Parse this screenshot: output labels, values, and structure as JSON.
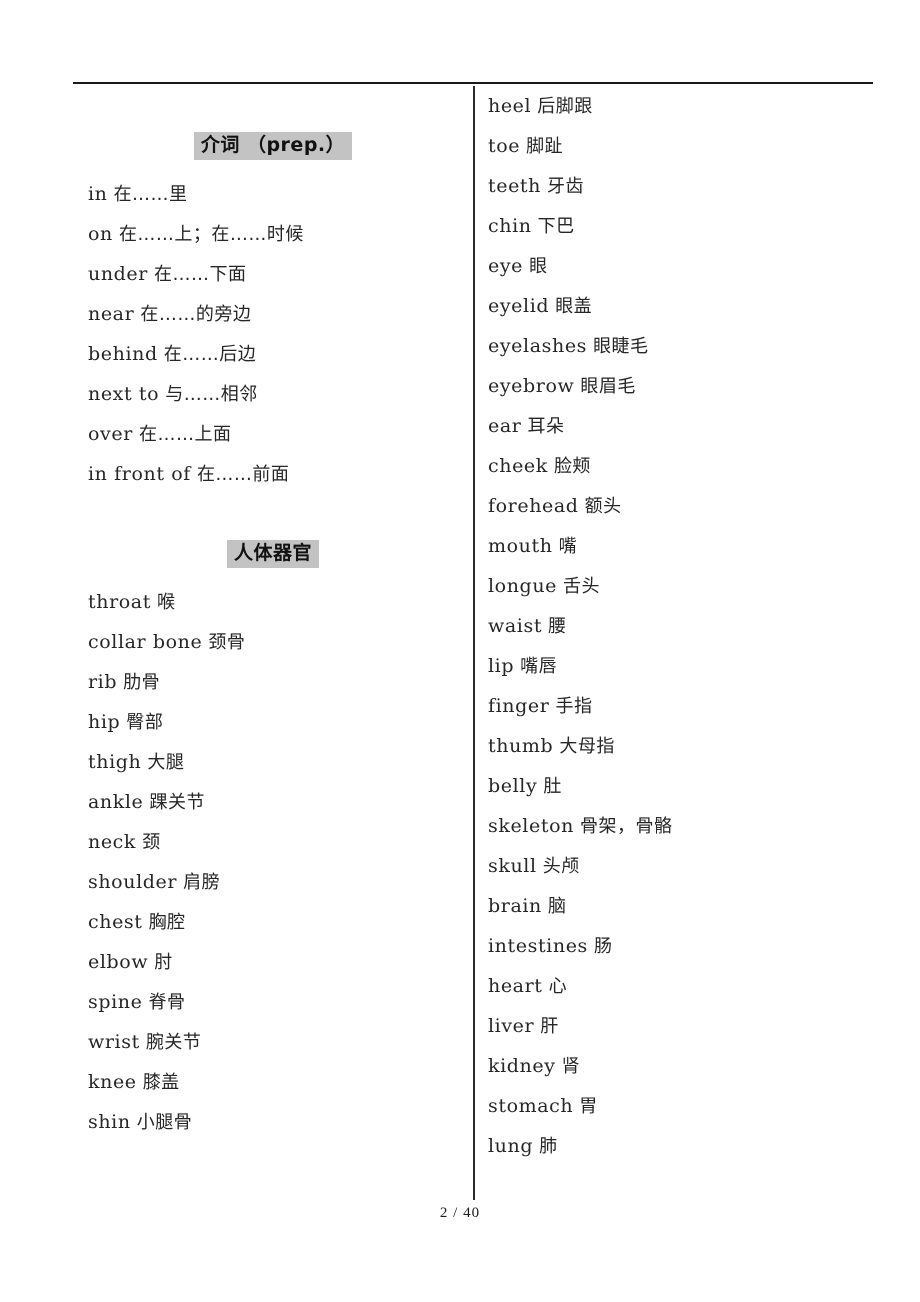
{
  "document": {
    "footer": "2 / 40"
  },
  "left_column": {
    "sections": [
      {
        "heading": "介词 （prep.）",
        "entries": [
          {
            "en": "in",
            "zh": "在……里"
          },
          {
            "en": "on",
            "zh": "在……上；在……时候"
          },
          {
            "en": "under",
            "zh": "在……下面"
          },
          {
            "en": "near",
            "zh": "在……的旁边"
          },
          {
            "en": "behind",
            "zh": "在……后边"
          },
          {
            "en": "next to",
            "zh": "与……相邻"
          },
          {
            "en": "over",
            "zh": "在……上面"
          },
          {
            "en": "in front of",
            "zh": "在……前面"
          }
        ]
      },
      {
        "heading": "人体器官",
        "entries": [
          {
            "en": "throat",
            "zh": "喉"
          },
          {
            "en": "collar bone",
            "zh": "颈骨"
          },
          {
            "en": "rib",
            "zh": "肋骨"
          },
          {
            "en": "hip",
            "zh": "臀部"
          },
          {
            "en": "thigh",
            "zh": "大腿"
          },
          {
            "en": "ankle",
            "zh": "踝关节"
          },
          {
            "en": "neck",
            "zh": "颈"
          },
          {
            "en": "shoulder",
            "zh": "肩膀"
          },
          {
            "en": "chest",
            "zh": "胸腔"
          },
          {
            "en": "elbow",
            "zh": "肘"
          },
          {
            "en": "spine",
            "zh": "脊骨"
          },
          {
            "en": "wrist",
            "zh": "腕关节"
          },
          {
            "en": "knee",
            "zh": "膝盖"
          },
          {
            "en": "shin",
            "zh": "小腿骨"
          }
        ]
      }
    ]
  },
  "right_column": {
    "entries": [
      {
        "en": "heel",
        "zh": "后脚跟"
      },
      {
        "en": "toe",
        "zh": "脚趾"
      },
      {
        "en": "teeth",
        "zh": "牙齿"
      },
      {
        "en": "chin",
        "zh": "下巴"
      },
      {
        "en": "eye",
        "zh": "眼"
      },
      {
        "en": "eyelid",
        "zh": "眼盖"
      },
      {
        "en": "eyelashes",
        "zh": "眼睫毛"
      },
      {
        "en": "eyebrow",
        "zh": "眼眉毛"
      },
      {
        "en": "ear",
        "zh": "耳朵"
      },
      {
        "en": "cheek",
        "zh": "脸颊"
      },
      {
        "en": "forehead",
        "zh": "额头"
      },
      {
        "en": "mouth",
        "zh": "嘴"
      },
      {
        "en": "longue",
        "zh": "舌头"
      },
      {
        "en": "waist",
        "zh": "腰"
      },
      {
        "en": "lip",
        "zh": "嘴唇"
      },
      {
        "en": "finger",
        "zh": "手指"
      },
      {
        "en": "thumb",
        "zh": "大母指"
      },
      {
        "en": "belly",
        "zh": "肚"
      },
      {
        "en": "skeleton",
        "zh": "骨架，骨骼"
      },
      {
        "en": "skull",
        "zh": "头颅"
      },
      {
        "en": "brain",
        "zh": "脑"
      },
      {
        "en": "intestines",
        "zh": "肠"
      },
      {
        "en": "heart",
        "zh": "心"
      },
      {
        "en": "liver",
        "zh": "肝"
      },
      {
        "en": "kidney",
        "zh": "肾"
      },
      {
        "en": "stomach",
        "zh": "胃"
      },
      {
        "en": "lung",
        "zh": "肺"
      }
    ]
  }
}
